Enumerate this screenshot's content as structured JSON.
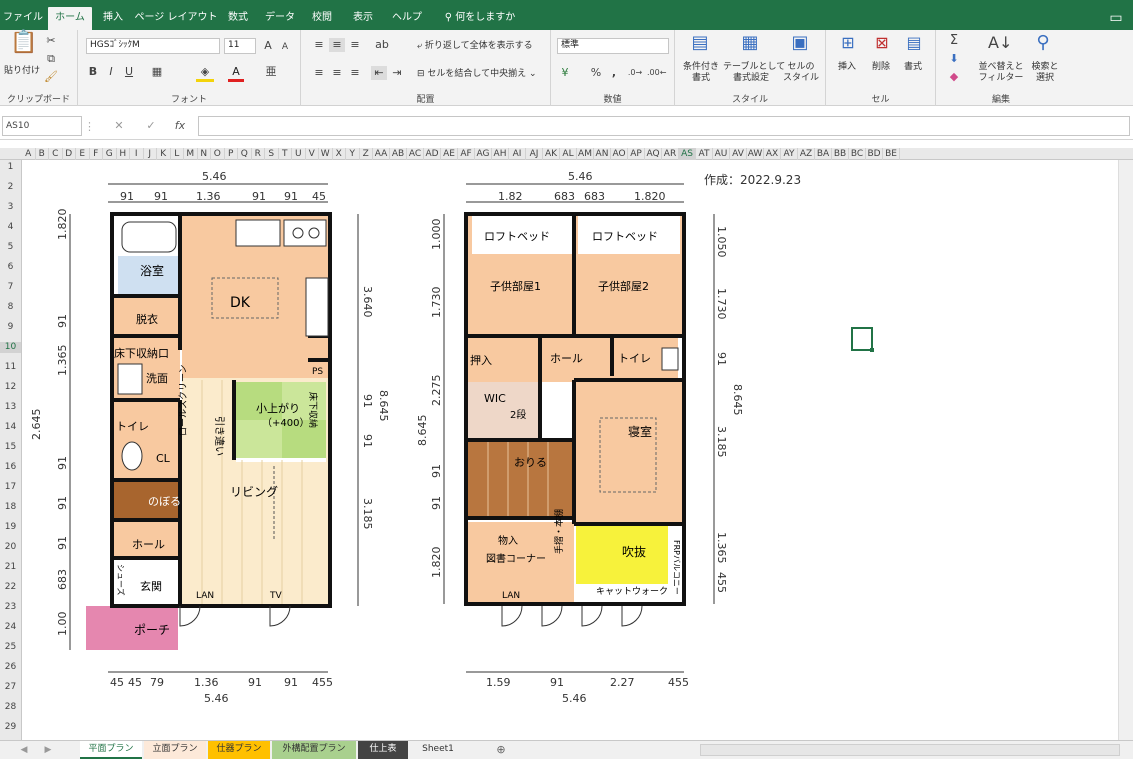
{
  "ribbon_tabs": [
    "ファイル",
    "ホーム",
    "挿入",
    "ページ レイアウト",
    "数式",
    "データ",
    "校閲",
    "表示",
    "ヘルプ",
    "何をしますか"
  ],
  "ribbon": {
    "paste": "貼り付け",
    "clipboard": "クリップボード",
    "font_name": "HGSｺﾞｼｯｸM",
    "font_size": "11",
    "font_group": "フォント",
    "wrap_text": "折り返して全体を表示する",
    "merge_center": "セルを結合して中央揃え",
    "align_group": "配置",
    "number_format": "標準",
    "number_group": "数値",
    "cond_format": "条件付き\n書式",
    "table_format": "テーブルとして\n書式設定",
    "cell_style": "セルの\nスタイル",
    "style_group": "スタイル",
    "insert": "挿入",
    "delete": "削除",
    "format": "書式",
    "cells_group": "セル",
    "sort": "並べ替えと\nフィルター",
    "find": "検索と\n選択",
    "edit_group": "編集"
  },
  "formula_bar": {
    "name_box": "AS10",
    "formula": ""
  },
  "columns": [
    "A",
    "B",
    "C",
    "D",
    "E",
    "F",
    "G",
    "H",
    "I",
    "J",
    "K",
    "L",
    "M",
    "N",
    "O",
    "P",
    "Q",
    "R",
    "S",
    "T",
    "U",
    "V",
    "W",
    "X",
    "Y",
    "Z",
    "AA",
    "AB",
    "AC",
    "AD",
    "AE",
    "AF",
    "AG",
    "AH",
    "AI",
    "AJ",
    "AK",
    "AL",
    "AM",
    "AN",
    "AO",
    "AP",
    "AQ",
    "AR",
    "AS",
    "AT",
    "AU",
    "AV",
    "AW",
    "AX",
    "AY",
    "AZ",
    "BA",
    "BB",
    "BC",
    "BD",
    "BE"
  ],
  "rows": [
    "1",
    "2",
    "3",
    "4",
    "5",
    "6",
    "7",
    "8",
    "9",
    "10",
    "11",
    "12",
    "13",
    "14",
    "15",
    "16",
    "17",
    "18",
    "19",
    "20",
    "21",
    "22",
    "23",
    "24",
    "25",
    "26",
    "27",
    "28",
    "29"
  ],
  "sheet_tabs": [
    "平面プラン",
    "立面プラン",
    "仕器プラン",
    "外構配置プラン",
    "仕上表",
    "Sheet1"
  ],
  "plan": {
    "date": "作成：2022.9.23",
    "top_total": "5.46",
    "top_dims": [
      "91",
      "91",
      "1.36",
      "91",
      "91",
      "45"
    ],
    "top_total2": "5.46",
    "top_dims2": [
      "1.82",
      "683",
      "683",
      "1.820"
    ],
    "bot_dims": [
      "45",
      "45",
      "79",
      "1.36",
      "91",
      "91",
      "455"
    ],
    "bot_total": "5.46",
    "bot_dims2": [
      "1.59",
      "91",
      "2.27",
      "455"
    ],
    "bot_total2": "5.46",
    "left_dims": [
      "1.820",
      "91",
      "1.365",
      "2.645",
      "91",
      "91",
      "91",
      "683",
      "1.00"
    ],
    "right_dims": [
      "3.640",
      "91",
      "91",
      "3.185"
    ],
    "right_total": "8.645",
    "left_dims2": [
      "1.000",
      "1.730",
      "2.275",
      "8.645",
      "91",
      "91",
      "1.820"
    ],
    "right_dims2": [
      "1.050",
      "1.730",
      "91",
      "3.185",
      "1.365",
      "455"
    ],
    "right_total2": "8.645",
    "r1": {
      "bath": "浴室",
      "dk": "DK",
      "dress": "脱衣",
      "storage": "床下収納口",
      "wash": "洗面",
      "toilet": "トイレ",
      "cl": "CL",
      "up": "のぼる",
      "hall": "ホール",
      "entry": "玄関",
      "porch": "ポーチ",
      "tatami": "小上がり",
      "tatami_sub": "（+400）",
      "living": "リビング",
      "door": "引き違い",
      "lan": "LAN",
      "tv": "TV",
      "ps": "PS",
      "shelf": "シューズ",
      "closet": "ロールスクリーン",
      "storage_flag": "床下収納"
    },
    "r2": {
      "loft1": "ロフトベッド",
      "loft2": "ロフトベッド",
      "kid1": "子供部屋1",
      "kid2": "子供部屋2",
      "hall": "ホール",
      "toilet": "トイレ",
      "push": "押入",
      "wic": "WIC",
      "step": "2段",
      "down": "おりる",
      "bed": "寝室",
      "book": "図書コーナー",
      "shelf": "物入",
      "void": "吹抜",
      "catwalk": "キャットウォーク",
      "lan": "LAN",
      "frp": "FRPバルコニー",
      "shelf2": "手摺・本棚"
    }
  }
}
